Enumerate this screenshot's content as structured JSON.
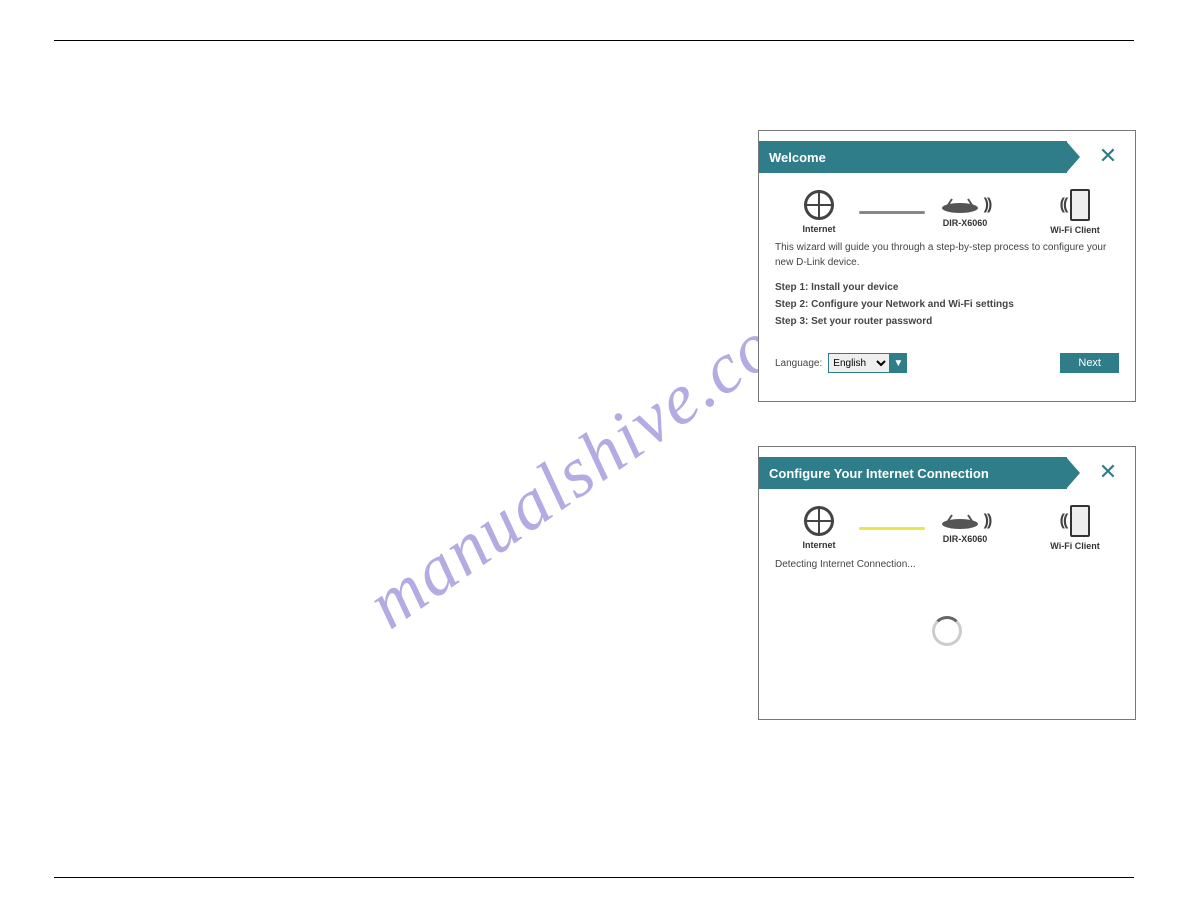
{
  "watermark": "manualshive.com",
  "panel1": {
    "title": "Welcome",
    "topology": {
      "internet_label": "Internet",
      "router_label": "DIR-X6060",
      "client_label": "Wi-Fi Client"
    },
    "intro": "This wizard will guide you through a step-by-step process to configure your new D-Link device.",
    "steps": [
      "Step 1: Install your device",
      "Step 2: Configure your Network and Wi-Fi settings",
      "Step 3: Set your router password"
    ],
    "language_label": "Language:",
    "language_value": "English",
    "next_label": "Next"
  },
  "panel2": {
    "title": "Configure Your Internet Connection",
    "topology": {
      "internet_label": "Internet",
      "router_label": "DIR-X6060",
      "client_label": "Wi-Fi Client"
    },
    "detecting": "Detecting Internet Connection..."
  }
}
